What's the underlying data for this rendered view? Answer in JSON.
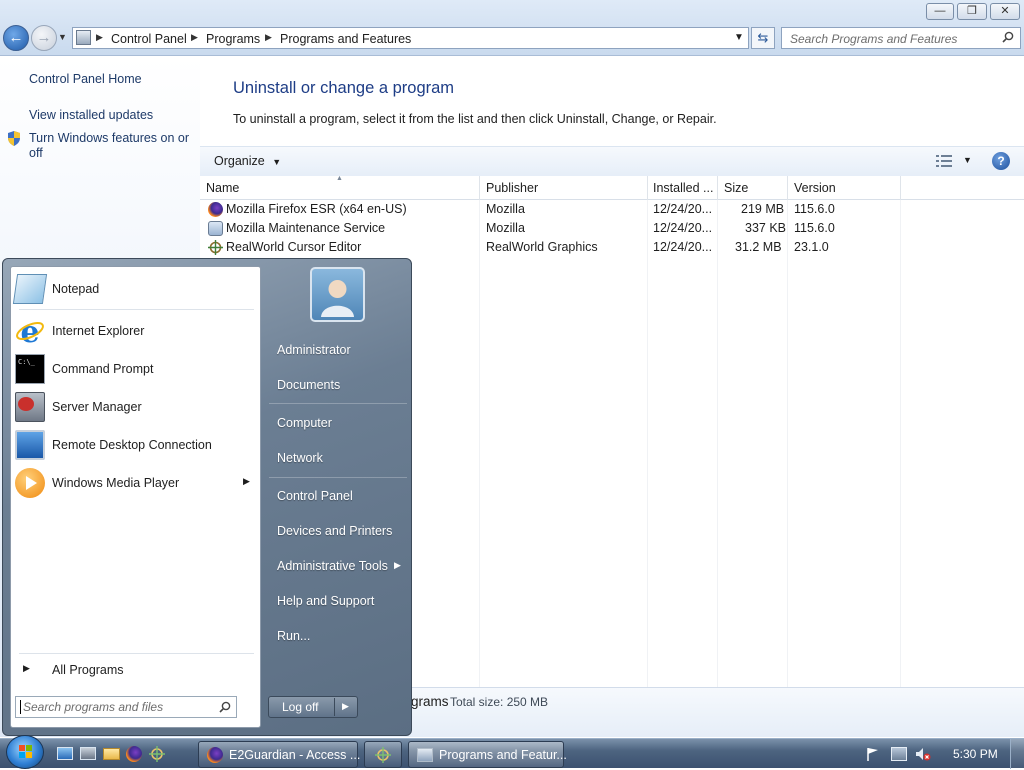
{
  "window": {
    "address": [
      "Control Panel",
      "Programs",
      "Programs and Features"
    ],
    "search_placeholder": "Search Programs and Features"
  },
  "left_pane": {
    "links": [
      "Control Panel Home",
      "View installed updates",
      "Turn Windows features on or off"
    ]
  },
  "main": {
    "title": "Uninstall or change a program",
    "description": "To uninstall a program, select it from the list and then click Uninstall, Change, or Repair.",
    "organize_label": "Organize",
    "columns": [
      "Name",
      "Publisher",
      "Installed ...",
      "Size",
      "Version"
    ],
    "programs": [
      {
        "name": "Mozilla Firefox ESR (x64 en-US)",
        "publisher": "Mozilla",
        "installed": "12/24/20...",
        "size": "219 MB",
        "version": "115.6.0",
        "icon": "firefox-icon"
      },
      {
        "name": "Mozilla Maintenance Service",
        "publisher": "Mozilla",
        "installed": "12/24/20...",
        "size": "337 KB",
        "version": "115.6.0",
        "icon": "maintenance-service-icon"
      },
      {
        "name": "RealWorld Cursor Editor",
        "publisher": "RealWorld Graphics",
        "installed": "12/24/20...",
        "size": "31.2 MB",
        "version": "23.1.0",
        "icon": "cursor-editor-icon"
      }
    ],
    "details_partial": "grams",
    "details_total": "Total size: 250 MB"
  },
  "start_menu": {
    "programs": [
      {
        "label": "Notepad",
        "icon": "notepad-icon"
      },
      {
        "label": "Internet Explorer",
        "icon": "internet-explorer-icon"
      },
      {
        "label": "Command Prompt",
        "icon": "command-prompt-icon"
      },
      {
        "label": "Server Manager",
        "icon": "server-manager-icon"
      },
      {
        "label": "Remote Desktop Connection",
        "icon": "remote-desktop-icon"
      },
      {
        "label": "Windows Media Player",
        "icon": "media-player-icon"
      }
    ],
    "all_programs": "All Programs",
    "search_placeholder": "Search programs and files",
    "right_links": [
      "Administrator",
      "Documents",
      "Computer",
      "Network",
      "Control Panel",
      "Devices and Printers",
      "Administrative Tools",
      "Help and Support",
      "Run..."
    ],
    "logoff": "Log off"
  },
  "taskbar": {
    "tasks": [
      "E2Guardian - Access ...",
      "Programs and Featur..."
    ],
    "clock": "5:30 PM"
  }
}
